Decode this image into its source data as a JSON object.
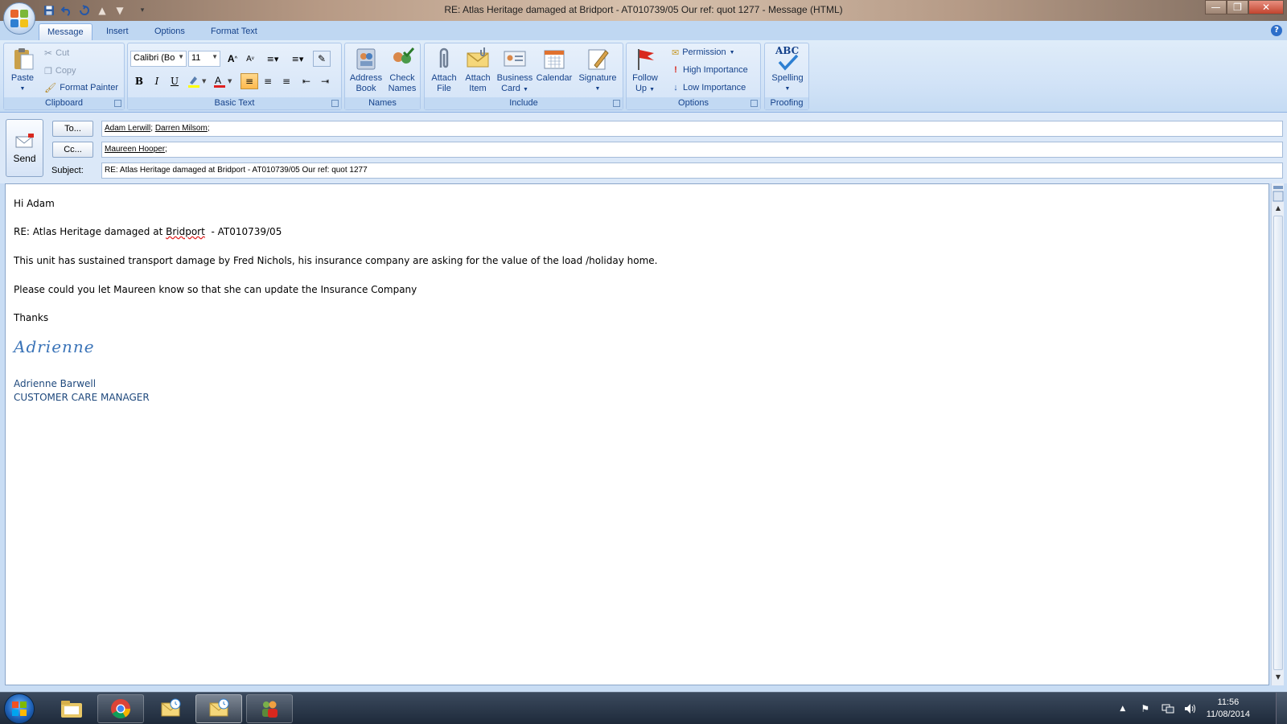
{
  "window": {
    "title": "RE: Atlas Heritage damaged at Bridport  - AT010739/05 Our ref: quot 1277  - Message (HTML)"
  },
  "tabs": [
    {
      "label": "Message",
      "active": true
    },
    {
      "label": "Insert"
    },
    {
      "label": "Options"
    },
    {
      "label": "Format Text"
    }
  ],
  "ribbon": {
    "clipboard": {
      "label": "Clipboard",
      "paste": "Paste",
      "cut": "Cut",
      "copy": "Copy",
      "format_painter": "Format Painter"
    },
    "basic_text": {
      "label": "Basic Text",
      "font_name": "Calibri (Bo",
      "font_size": "11",
      "bold": "B",
      "italic": "I",
      "underline": "U"
    },
    "names": {
      "label": "Names",
      "address_book_1": "Address",
      "address_book_2": "Book",
      "check_names_1": "Check",
      "check_names_2": "Names"
    },
    "include": {
      "label": "Include",
      "attach_file_1": "Attach",
      "attach_file_2": "File",
      "attach_item_1": "Attach",
      "attach_item_2": "Item",
      "business_card_1": "Business",
      "business_card_2": "Card",
      "calendar": "Calendar",
      "signature": "Signature"
    },
    "options": {
      "label": "Options",
      "follow_up_1": "Follow",
      "follow_up_2": "Up",
      "permission": "Permission",
      "high_importance": "High Importance",
      "low_importance": "Low Importance"
    },
    "proofing": {
      "label": "Proofing",
      "spelling": "Spelling",
      "abc": "ABC"
    }
  },
  "header": {
    "send": "Send",
    "to_button": "To...",
    "cc_button": "Cc...",
    "subject_label": "Subject:",
    "to": [
      "Adam Lerwill",
      "Darren Milsom"
    ],
    "cc": [
      "Maureen Hooper"
    ],
    "subject": "RE: Atlas Heritage damaged at Bridport  - AT010739/05 Our ref: quot 1277"
  },
  "body": {
    "greeting": "Hi Adam",
    "ref_prefix": "RE: Atlas Heritage damaged at ",
    "ref_place": "Bridport",
    "ref_suffix": "  - AT010739/05",
    "para1": "This unit has sustained transport damage by Fred Nichols, his insurance company are asking for the value of the load /holiday home.",
    "para2": "Please could you let Maureen know so that she can update the Insurance Company",
    "thanks": "Thanks",
    "signature_script": "Adrienne",
    "signature_name": "Adrienne Barwell",
    "signature_title": "CUSTOMER CARE MANAGER"
  },
  "taskbar": {
    "clock_time": "11:56",
    "clock_date": "11/08/2014"
  },
  "colors": {
    "ribbon_text": "#15428b",
    "signature_blue": "#3b74b8",
    "signature_name": "#1f497d",
    "highlight_yellow": "#ffff00",
    "font_color_red": "#e02020"
  }
}
